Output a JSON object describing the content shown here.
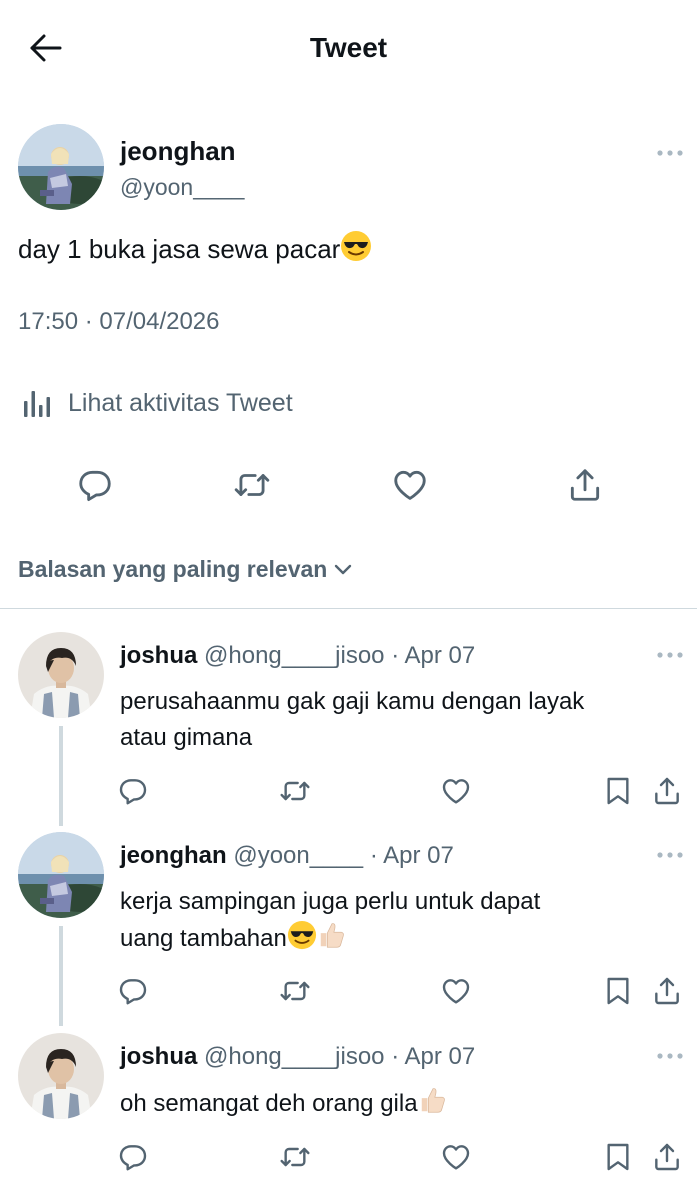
{
  "header": {
    "title": "Tweet"
  },
  "tweet": {
    "author_name": "jeonghan",
    "author_handle": "@yoon____",
    "text": "day 1 buka jasa sewa pacar",
    "timestamp": "17:50 · 07/04/2026",
    "activity_label": "Lihat aktivitas Tweet"
  },
  "sort_label": "Balasan yang paling relevan",
  "replies": [
    {
      "name": "joshua",
      "handle": "@hong____jisoo",
      "date": "· Apr 07",
      "line1": "perusahaanmu gak gaji kamu dengan layak",
      "line2": "atau gimana"
    },
    {
      "name": "jeonghan",
      "handle": "@yoon____",
      "date": "· Apr 07",
      "line1": "kerja sampingan juga perlu untuk dapat",
      "line2": "uang tambahan"
    },
    {
      "name": "joshua",
      "handle": "@hong____jisoo",
      "date": "· Apr 07",
      "line1": "oh semangat deh orang gila",
      "line2": ""
    }
  ],
  "colors": {
    "text": "#0f1419",
    "secondary": "#536471",
    "divider": "#cfd9de"
  },
  "icons": [
    "back-arrow-icon",
    "more-icon",
    "analytics-icon",
    "reply-icon",
    "retweet-icon",
    "like-icon",
    "share-icon",
    "bookmark-icon",
    "chevron-down-icon",
    "sunglasses-emoji",
    "thumbs-up-emoji"
  ]
}
